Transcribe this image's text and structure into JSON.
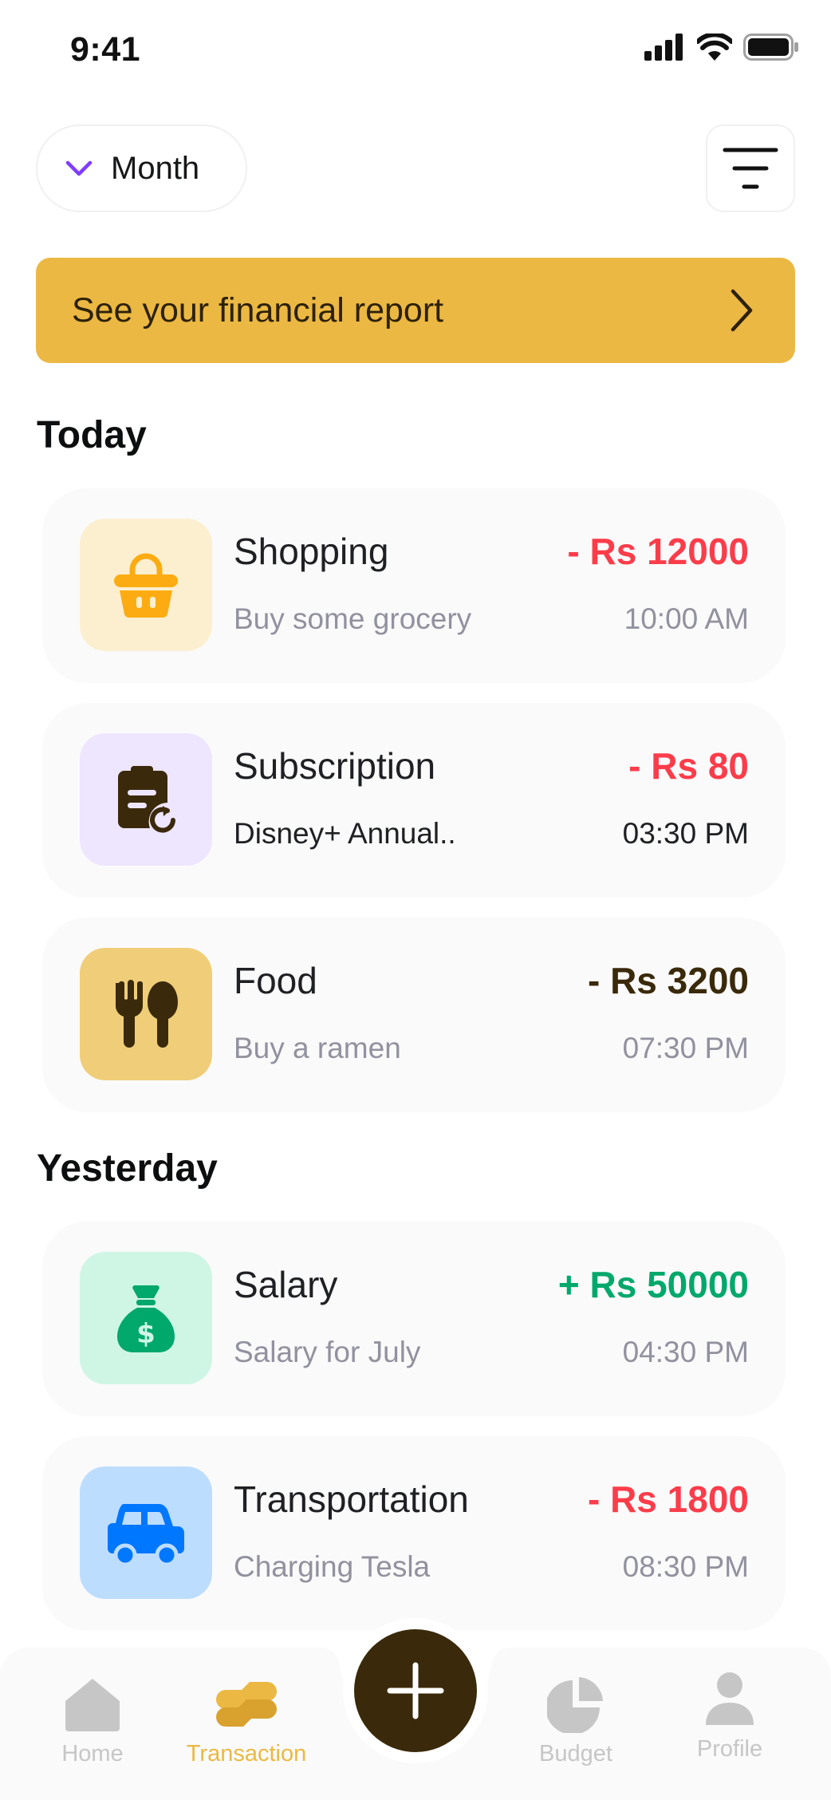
{
  "status_bar": {
    "time": "9:41"
  },
  "header": {
    "period_label": "Month"
  },
  "report_banner": {
    "text": "See your financial report"
  },
  "sections": [
    {
      "title": "Today",
      "transactions": [
        {
          "category": "Shopping",
          "description": "Buy some grocery",
          "amount": "- Rs 12000",
          "time": "10:00 AM",
          "icon": "shopping-basket-icon",
          "amount_color": "#fd3c4a",
          "icon_bg": "#fcefd0",
          "icon_color": "#fcac12"
        },
        {
          "category": "Subscription",
          "description": "Disney+ Annual..",
          "amount": "- Rs 80",
          "time": "03:30 PM",
          "icon": "recurring-bill-icon",
          "amount_color": "#fd3c4a",
          "icon_bg": "#eee5ff",
          "icon_color": "#3a2a0b"
        },
        {
          "category": "Food",
          "description": "Buy a ramen",
          "amount": "- Rs 3200",
          "time": "07:30 PM",
          "icon": "restaurant-icon",
          "amount_color": "#3a2a0b",
          "icon_bg": "#f0cd78",
          "icon_color": "#3a2a0b"
        }
      ]
    },
    {
      "title": "Yesterday",
      "transactions": [
        {
          "category": "Salary",
          "description": "Salary for July",
          "amount": "+ Rs 50000",
          "time": "04:30 PM",
          "icon": "money-bag-icon",
          "amount_color": "#00a86b",
          "icon_bg": "#cff6e5",
          "icon_color": "#00a86b"
        },
        {
          "category": "Transportation",
          "description": "Charging Tesla",
          "amount": "- Rs 1800",
          "time": "08:30 PM",
          "icon": "car-icon",
          "amount_color": "#fd3c4a",
          "icon_bg": "#bdddff",
          "icon_color": "#0077ff"
        }
      ]
    }
  ],
  "bottom_nav": {
    "items": [
      {
        "label": "Home",
        "icon": "home-icon",
        "active": false
      },
      {
        "label": "Transaction",
        "icon": "transaction-icon",
        "active": true
      },
      {
        "label": "Budget",
        "icon": "pie-chart-icon",
        "active": false
      },
      {
        "label": "Profile",
        "icon": "user-icon",
        "active": false
      }
    ],
    "fab_icon": "plus-icon",
    "active_color": "#ebb843",
    "inactive_color": "#c6c6c6"
  }
}
